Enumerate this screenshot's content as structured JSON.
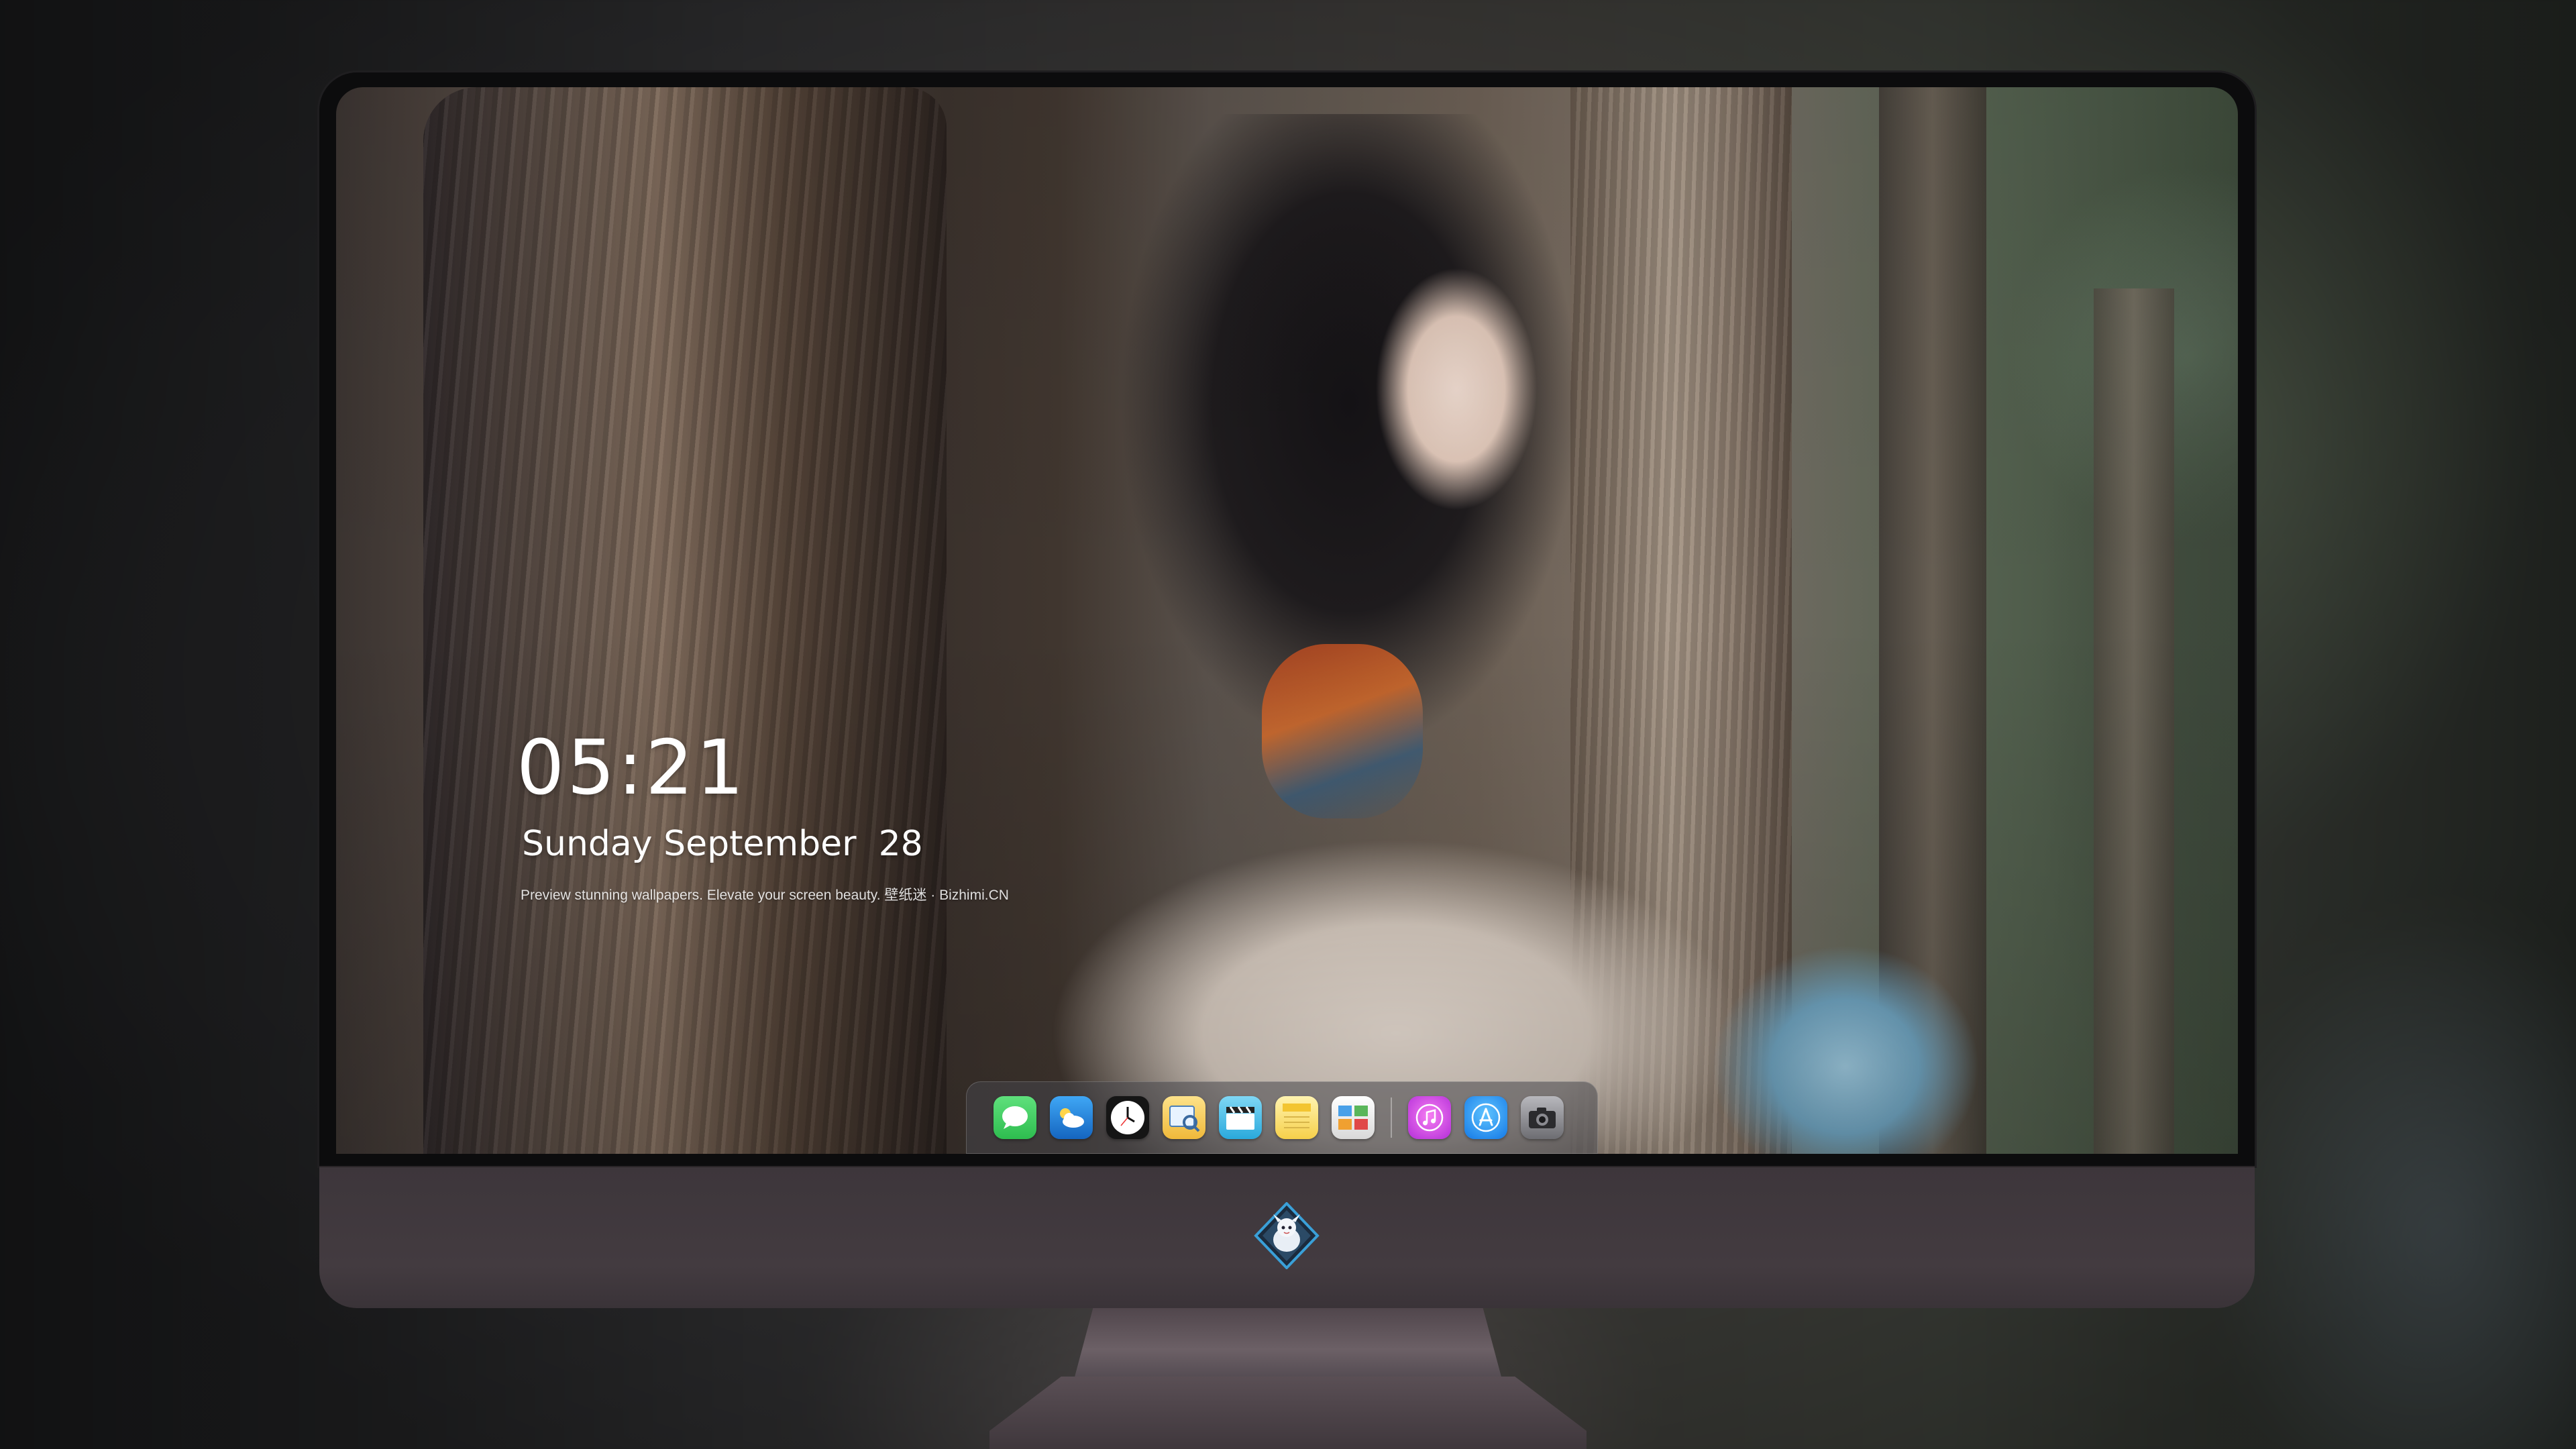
{
  "lockscreen": {
    "time": "05:21",
    "weekday": "Sunday",
    "month": "September",
    "day": "28",
    "tagline": "Preview stunning wallpapers. Elevate your screen beauty. 壁纸迷 · Bizhimi.CN"
  },
  "dock": {
    "apps": [
      {
        "icon": "messages-icon",
        "color": "#34c759"
      },
      {
        "icon": "weather-icon",
        "color": "#1e88e5"
      },
      {
        "icon": "clock-icon",
        "color": "#111111"
      },
      {
        "icon": "preview-icon",
        "color": "#f2c24a"
      },
      {
        "icon": "clips-icon",
        "color": "#3cb4e6"
      },
      {
        "icon": "notes-icon",
        "color": "#f7d34a"
      },
      {
        "icon": "photo-booth-icon",
        "color": "#f2f2f2"
      },
      {
        "icon": "itunes-icon",
        "color": "#d446e6"
      },
      {
        "icon": "app-store-icon",
        "color": "#1c8ef5"
      },
      {
        "icon": "camera-icon",
        "color": "#8e8e93"
      }
    ]
  },
  "monitor": {
    "chin_logo": "dragon-mascot-logo"
  }
}
